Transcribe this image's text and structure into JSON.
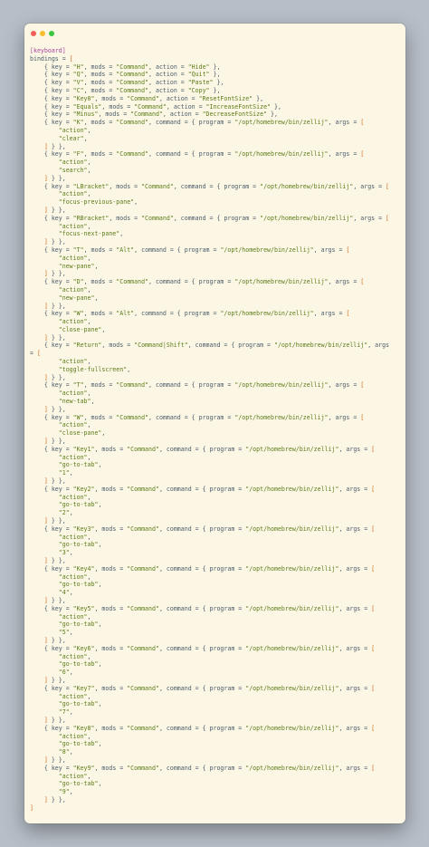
{
  "window": {
    "colors": {
      "background": "#fcf7e4",
      "text": "#4a5b6b",
      "section": "#a4449c"
    }
  },
  "code": {
    "lines": [
      "[keyboard]",
      "bindings = [",
      "    { key = \"H\", mods = \"Command\", action = \"Hide\" },",
      "    { key = \"Q\", mods = \"Command\", action = \"Quit\" },",
      "    { key = \"V\", mods = \"Command\", action = \"Paste\" },",
      "    { key = \"C\", mods = \"Command\", action = \"Copy\" },",
      "    { key = \"Key0\", mods = \"Command\", action = \"ResetFontSize\" },",
      "    { key = \"Equals\", mods = \"Command\", action = \"IncreaseFontSize\" },",
      "    { key = \"Minus\", mods = \"Command\", action = \"DecreaseFontSize\" },",
      "    { key = \"K\", mods = \"Command\", command = { program = \"/opt/homebrew/bin/zellij\", args = [",
      "        \"action\",",
      "        \"clear\",",
      "    ] } },",
      "    { key = \"F\", mods = \"Command\", command = { program = \"/opt/homebrew/bin/zellij\", args = [",
      "        \"action\",",
      "        \"search\",",
      "    ] } },",
      "    { key = \"LBracket\", mods = \"Command\", command = { program = \"/opt/homebrew/bin/zellij\", args = [",
      "        \"action\",",
      "        \"focus-previous-pane\",",
      "    ] } },",
      "    { key = \"RBracket\", mods = \"Command\", command = { program = \"/opt/homebrew/bin/zellij\", args = [",
      "        \"action\",",
      "        \"focus-next-pane\",",
      "    ] } },",
      "    { key = \"T\", mods = \"Alt\", command = { program = \"/opt/homebrew/bin/zellij\", args = [",
      "        \"action\",",
      "        \"new-pane\",",
      "    ] } },",
      "    { key = \"D\", mods = \"Command\", command = { program = \"/opt/homebrew/bin/zellij\", args = [",
      "        \"action\",",
      "        \"new-pane\",",
      "    ] } },",
      "    { key = \"W\", mods = \"Alt\", command = { program = \"/opt/homebrew/bin/zellij\", args = [",
      "        \"action\",",
      "        \"close-pane\",",
      "    ] } },",
      "    { key = \"Return\", mods = \"Command|Shift\", command = { program = \"/opt/homebrew/bin/zellij\", args",
      "= [",
      "        \"action\",",
      "        \"toggle-fullscreen\",",
      "    ] } },",
      "    { key = \"T\", mods = \"Command\", command = { program = \"/opt/homebrew/bin/zellij\", args = [",
      "        \"action\",",
      "        \"new-tab\",",
      "    ] } },",
      "    { key = \"W\", mods = \"Command\", command = { program = \"/opt/homebrew/bin/zellij\", args = [",
      "        \"action\",",
      "        \"close-pane\",",
      "    ] } },",
      "    { key = \"Key1\", mods = \"Command\", command = { program = \"/opt/homebrew/bin/zellij\", args = [",
      "        \"action\",",
      "        \"go-to-tab\",",
      "        \"1\",",
      "    ] } },",
      "    { key = \"Key2\", mods = \"Command\", command = { program = \"/opt/homebrew/bin/zellij\", args = [",
      "        \"action\",",
      "        \"go-to-tab\",",
      "        \"2\",",
      "    ] } },",
      "    { key = \"Key3\", mods = \"Command\", command = { program = \"/opt/homebrew/bin/zellij\", args = [",
      "        \"action\",",
      "        \"go-to-tab\",",
      "        \"3\",",
      "    ] } },",
      "    { key = \"Key4\", mods = \"Command\", command = { program = \"/opt/homebrew/bin/zellij\", args = [",
      "        \"action\",",
      "        \"go-to-tab\",",
      "        \"4\",",
      "    ] } },",
      "    { key = \"Key5\", mods = \"Command\", command = { program = \"/opt/homebrew/bin/zellij\", args = [",
      "        \"action\",",
      "        \"go-to-tab\",",
      "        \"5\",",
      "    ] } },",
      "    { key = \"Key6\", mods = \"Command\", command = { program = \"/opt/homebrew/bin/zellij\", args = [",
      "        \"action\",",
      "        \"go-to-tab\",",
      "        \"6\",",
      "    ] } },",
      "    { key = \"Key7\", mods = \"Command\", command = { program = \"/opt/homebrew/bin/zellij\", args = [",
      "        \"action\",",
      "        \"go-to-tab\",",
      "        \"7\",",
      "    ] } },",
      "    { key = \"Key8\", mods = \"Command\", command = { program = \"/opt/homebrew/bin/zellij\", args = [",
      "        \"action\",",
      "        \"go-to-tab\",",
      "        \"8\",",
      "    ] } },",
      "    { key = \"Key9\", mods = \"Command\", command = { program = \"/opt/homebrew/bin/zellij\", args = [",
      "        \"action\",",
      "        \"go-to-tab\",",
      "        \"9\",",
      "    ] } },",
      "]"
    ]
  }
}
